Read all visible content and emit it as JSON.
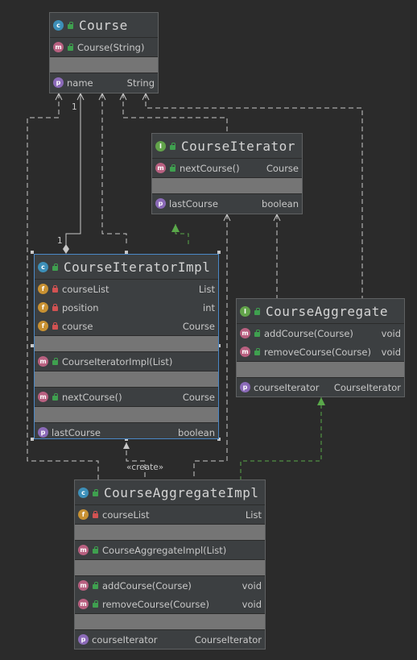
{
  "classes": {
    "course": {
      "name": "Course",
      "constructor": "Course(String)",
      "prop": {
        "name": "name",
        "type": "String"
      }
    },
    "course_iterator": {
      "name": "CourseIterator",
      "method": {
        "name": "nextCourse()",
        "type": "Course"
      },
      "prop": {
        "name": "lastCourse",
        "type": "boolean"
      }
    },
    "course_iterator_impl": {
      "name": "CourseIteratorImpl",
      "fields": [
        {
          "name": "courseList",
          "type": "List"
        },
        {
          "name": "position",
          "type": "int"
        },
        {
          "name": "course",
          "type": "Course"
        }
      ],
      "constructor": "CourseIteratorImpl(List)",
      "method": {
        "name": "nextCourse()",
        "type": "Course"
      },
      "prop": {
        "name": "lastCourse",
        "type": "boolean"
      }
    },
    "course_aggregate": {
      "name": "CourseAggregate",
      "methods": [
        {
          "name": "addCourse(Course)",
          "type": "void"
        },
        {
          "name": "removeCourse(Course)",
          "type": "void"
        }
      ],
      "prop": {
        "name": "courseIterator",
        "type": "CourseIterator"
      }
    },
    "course_aggregate_impl": {
      "name": "CourseAggregateImpl",
      "field": {
        "name": "courseList",
        "type": "List"
      },
      "constructor": "CourseAggregateImpl(List)",
      "methods": [
        {
          "name": "addCourse(Course)",
          "type": "void"
        },
        {
          "name": "removeCourse(Course)",
          "type": "void"
        }
      ],
      "prop": {
        "name": "courseIterator",
        "type": "CourseIterator"
      }
    }
  },
  "labels": {
    "create": "«create»",
    "multiplicity_top": "1",
    "multiplicity_bottom": "1"
  },
  "icons": {
    "class": "c",
    "interface": "I",
    "method": "m",
    "field": "f",
    "property": "p"
  },
  "colors": {
    "background": "#2b2b2b",
    "box": "#3c3f41",
    "selected_border": "#4a88c7",
    "realization": "#5aa84a",
    "dependency": "#a9b7c6"
  }
}
